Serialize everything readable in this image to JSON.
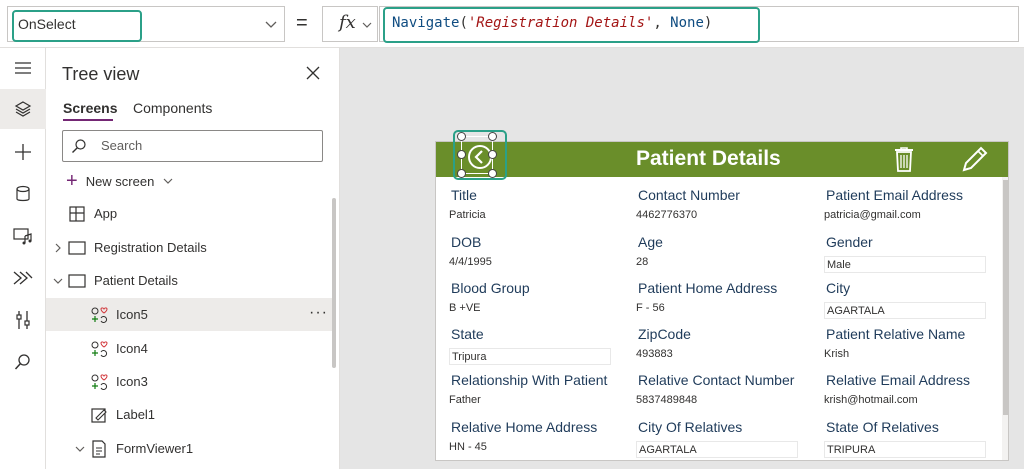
{
  "formula_bar": {
    "property": "OnSelect",
    "fx": "fx",
    "equals": "=",
    "formula": {
      "fn": "Navigate",
      "open": "(",
      "str": "'Registration Details'",
      "comma": ", ",
      "arg2": "None",
      "close": ")"
    }
  },
  "tree_view": {
    "title": "Tree view",
    "tabs": [
      "Screens",
      "Components"
    ],
    "search_placeholder": "Search",
    "new_screen_label": "New screen",
    "items": [
      {
        "label": "App"
      },
      {
        "label": "Registration Details"
      },
      {
        "label": "Patient Details"
      },
      {
        "label": "Icon5"
      },
      {
        "label": "Icon4"
      },
      {
        "label": "Icon3"
      },
      {
        "label": "Label1"
      },
      {
        "label": "FormViewer1"
      }
    ],
    "more": "···"
  },
  "screen": {
    "title": "Patient Details",
    "fields": [
      {
        "label": "Title",
        "value": "Patricia"
      },
      {
        "label": "Contact Number",
        "value": "4462776370"
      },
      {
        "label": "Patient Email Address",
        "value": "patricia@gmail.com"
      },
      {
        "label": "DOB",
        "value": "4/4/1995"
      },
      {
        "label": "Age",
        "value": "28"
      },
      {
        "label": "Gender",
        "value": "Male"
      },
      {
        "label": "Blood Group",
        "value": "B +VE"
      },
      {
        "label": "Patient Home Address",
        "value": "F - 56"
      },
      {
        "label": "City",
        "value": "AGARTALA"
      },
      {
        "label": "State",
        "value": "Tripura"
      },
      {
        "label": "ZipCode",
        "value": "493883"
      },
      {
        "label": "Patient Relative Name",
        "value": "Krish"
      },
      {
        "label": "Relationship With Patient",
        "value": "Father"
      },
      {
        "label": "Relative Contact Number",
        "value": "5837489848"
      },
      {
        "label": "Relative Email Address",
        "value": "krish@hotmail.com"
      },
      {
        "label": "Relative Home Address",
        "value": "HN - 45"
      },
      {
        "label": "City Of Relatives",
        "value": "AGARTALA"
      },
      {
        "label": "State Of Relatives",
        "value": "TRIPURA"
      }
    ]
  },
  "colors": {
    "header_green": "#6a8e2a",
    "highlight_teal": "#2ba088",
    "accent_purple": "#742774"
  }
}
